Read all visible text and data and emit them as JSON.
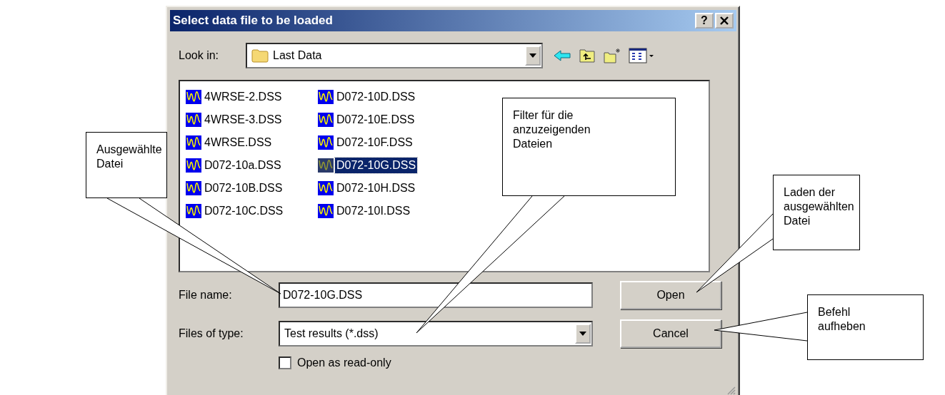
{
  "dialog": {
    "title": "Select data file to be loaded",
    "help": "?"
  },
  "look_in": {
    "label": "Look in:",
    "value": "Last Data"
  },
  "files": [
    {
      "name": "4WRSE-2.DSS",
      "selected": false
    },
    {
      "name": "4WRSE-3.DSS",
      "selected": false
    },
    {
      "name": "4WRSE.DSS",
      "selected": false
    },
    {
      "name": "D072-10a.DSS",
      "selected": false
    },
    {
      "name": "D072-10B.DSS",
      "selected": false
    },
    {
      "name": "D072-10C.DSS",
      "selected": false
    },
    {
      "name": "D072-10D.DSS",
      "selected": false
    },
    {
      "name": "D072-10E.DSS",
      "selected": false
    },
    {
      "name": "D072-10F.DSS",
      "selected": false
    },
    {
      "name": "D072-10G.DSS",
      "selected": true
    },
    {
      "name": "D072-10H.DSS",
      "selected": false
    },
    {
      "name": "D072-10I.DSS",
      "selected": false
    }
  ],
  "file_name": {
    "label": "File name:",
    "value": "D072-10G.DSS"
  },
  "file_type": {
    "label": "Files of type:",
    "value": "Test results (*.dss)"
  },
  "buttons": [
    "Open",
    "Cancel"
  ],
  "read_only": {
    "label": "Open as read-only",
    "checked": false
  },
  "callouts": [
    {
      "text": "Ausgewählte\nDatei"
    },
    {
      "text": "Filter für die\nanzuzeigenden\nDateien"
    },
    {
      "text": "Laden der\nausgewählten\nDatei"
    },
    {
      "text": "Befehl\naufheben"
    }
  ]
}
